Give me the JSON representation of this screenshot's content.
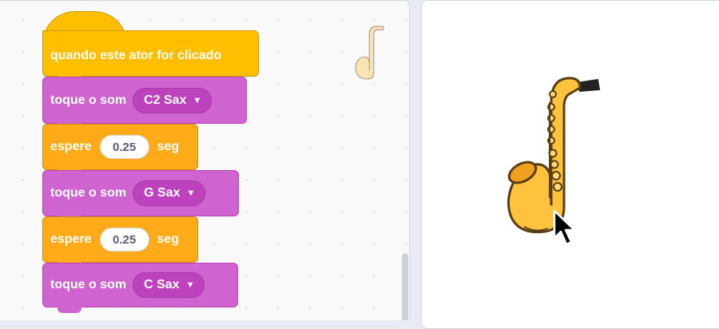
{
  "blocks": {
    "hat": {
      "label": "quando este ator for clicado"
    },
    "play1": {
      "label": "toque o som",
      "sound": "C2 Sax"
    },
    "wait1": {
      "label": "espere",
      "value": "0.25",
      "unit": "seg"
    },
    "play2": {
      "label": "toque o som",
      "sound": "G Sax"
    },
    "wait2": {
      "label": "espere",
      "value": "0.25",
      "unit": "seg"
    },
    "play3": {
      "label": "toque o som",
      "sound": "C Sax"
    }
  },
  "icons": {
    "dropdown": "triangle-down-icon",
    "sprite": "saxophone-icon",
    "cursor": "mouse-pointer-icon"
  },
  "colors": {
    "events": "#ffbf00",
    "sound": "#cf63cf",
    "control": "#ffab19",
    "saxophone": "#ffc23d"
  }
}
